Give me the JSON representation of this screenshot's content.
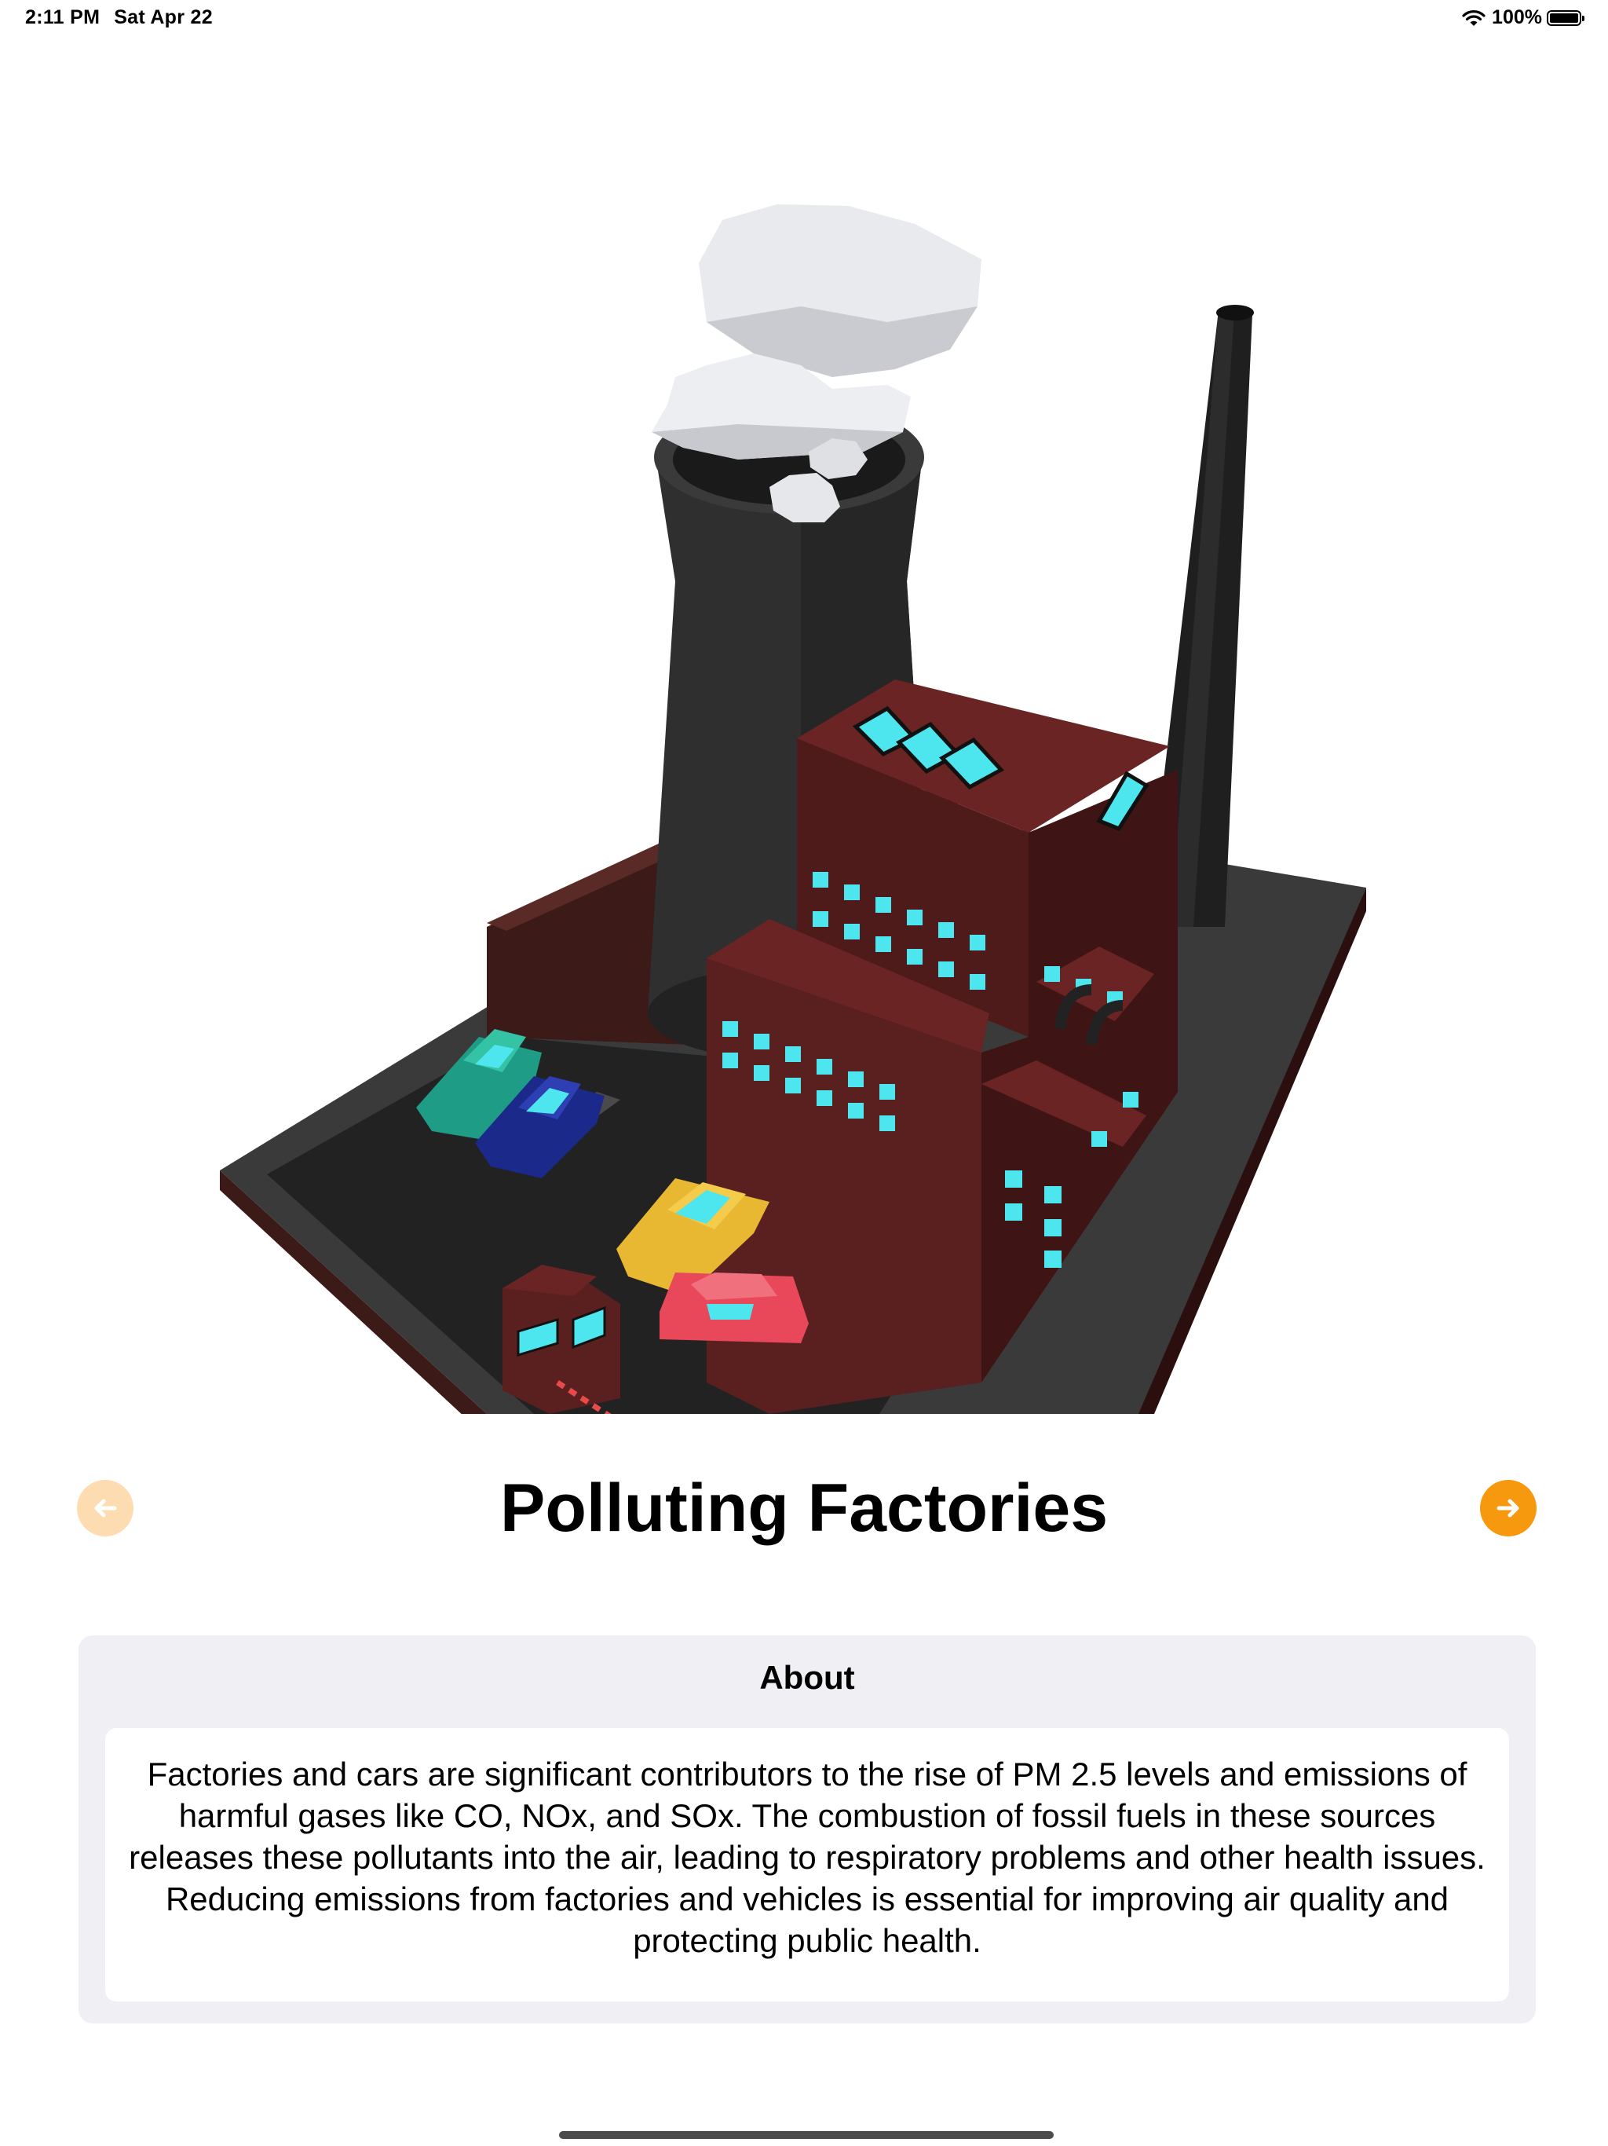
{
  "status_bar": {
    "time": "2:11 PM",
    "date": "Sat Apr 22",
    "battery_percent": "100%",
    "icons": [
      "wifi-icon",
      "battery-icon"
    ]
  },
  "scene": {
    "subject": "3d-factory-illustration"
  },
  "navigation": {
    "title": "Polluting Factories",
    "prev_icon": "arrow-left-circle-icon",
    "next_icon": "arrow-right-circle-icon",
    "prev_enabled": false,
    "next_enabled": true
  },
  "about": {
    "heading": "About",
    "body": "Factories and cars are significant contributors to the rise of PM 2.5 levels and emissions of harmful gases like CO, NOx, and SOx. The combustion of fossil fuels in these sources releases these pollutants into the air, leading to respiratory problems and other health issues. Reducing emissions from factories and vehicles is essential for improving air quality and protecting public health."
  },
  "colors": {
    "accent": "#f6990f",
    "accent_disabled": "#fcdcb0",
    "card_background": "#efeff4",
    "brick": "#5a1f1f",
    "window": "#4de6ee"
  }
}
